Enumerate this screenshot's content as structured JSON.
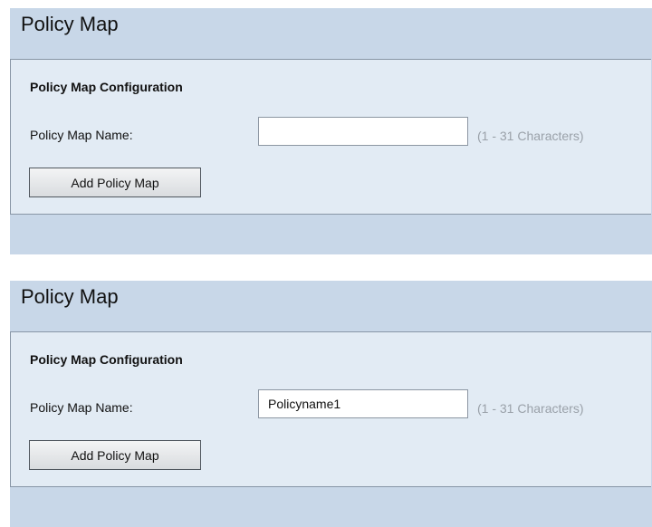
{
  "panels": [
    {
      "title": "Policy Map",
      "section_heading": "Policy Map Configuration",
      "field_label": "Policy Map Name:",
      "input_value": "",
      "hint": "(1 - 31 Characters)",
      "button_label": "Add Policy Map"
    },
    {
      "title": "Policy Map",
      "section_heading": "Policy Map Configuration",
      "field_label": "Policy Map Name:",
      "input_value": "Policyname1",
      "hint": "(1 - 31 Characters)",
      "button_label": "Add Policy Map"
    }
  ],
  "colors": {
    "panel_background": "#c8d7e8",
    "config_box_background": "#e2ebf4",
    "hint_text": "#9aa1a9"
  }
}
